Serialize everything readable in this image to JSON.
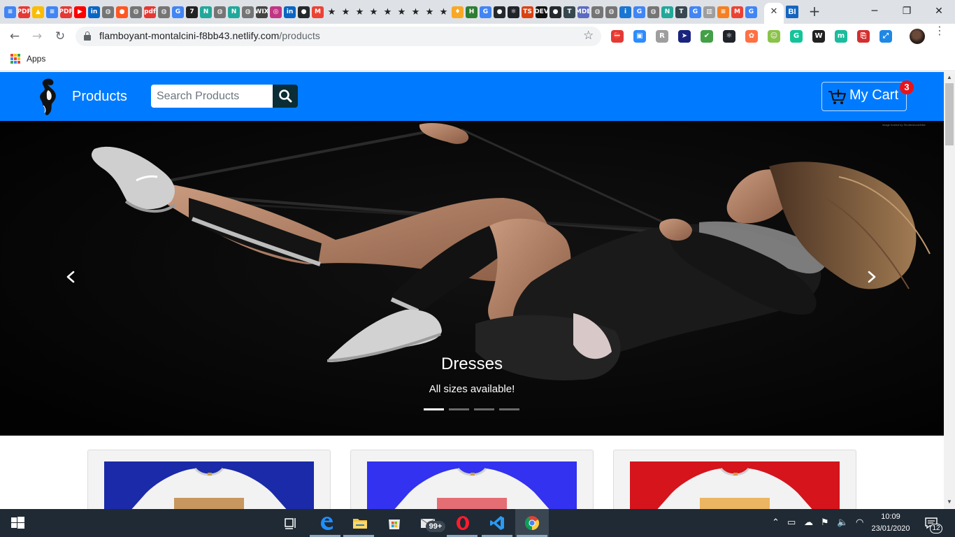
{
  "browser": {
    "url_domain": "flamboyant-montalcini-f8bb43.netlify.com",
    "url_path": "/products",
    "bookmarks": {
      "apps_label": "Apps"
    },
    "tabs": {
      "favicons": [
        "docs",
        "PDF",
        "drive",
        "docs",
        "PDF",
        "youtube",
        "in",
        "web",
        "orange",
        "web",
        "pdf",
        "web",
        "G",
        "7",
        "N",
        "web",
        "N",
        "web",
        "WIX",
        "insta",
        "in",
        "github",
        "M",
        "star",
        "star",
        "star",
        "star",
        "star",
        "star",
        "star",
        "star",
        "star",
        "leaf",
        "H",
        "G",
        "github",
        "react",
        "TS",
        "DEV",
        "github",
        "T",
        "MDB",
        "web",
        "web",
        "info",
        "G",
        "web",
        "N",
        "T",
        "G",
        "chart",
        "stack",
        "M",
        "G"
      ],
      "close_glyph": "✕",
      "active_tab_icon": "BI",
      "new_tab_glyph": "+"
    },
    "extensions": [
      "adblock",
      "zoom",
      "text",
      "cursor",
      "shield",
      "react",
      "graph",
      "face",
      "grammarly",
      "wordpress",
      "m",
      "acrobat",
      "resize"
    ]
  },
  "navbar": {
    "brand": "Products",
    "search_placeholder": "Search Products",
    "cart_label": "My Cart",
    "cart_count": "3"
  },
  "carousel": {
    "image_credit": "image hosted by Shutterstock/Nike",
    "slide_title": "Dresses",
    "slide_subtitle": "All sizes available!",
    "slide_count": 4,
    "active_slide": 0
  },
  "products": [
    {
      "bg_color": "#1a2aa8"
    },
    {
      "bg_color": "#3232f0"
    },
    {
      "bg_color": "#d5141c"
    }
  ],
  "taskbar": {
    "store_badge": "99+",
    "time": "10:09",
    "date": "23/01/2020",
    "notification_count": "12"
  }
}
